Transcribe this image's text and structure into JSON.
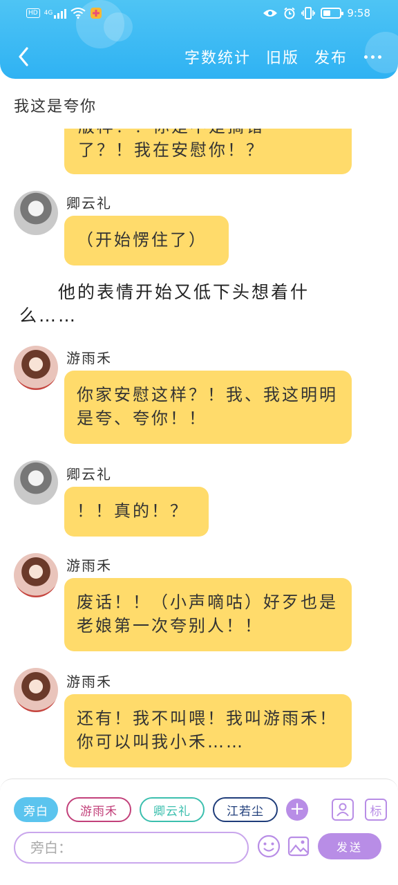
{
  "status_bar": {
    "hd": "HD",
    "network": "4G",
    "time": "9:58"
  },
  "header": {
    "actions": [
      {
        "label": "字数统计"
      },
      {
        "label": "旧版"
      },
      {
        "label": "发布"
      }
    ]
  },
  "chat": {
    "note_title": "我这是夸你",
    "partial_bubble_lines": [
      "版样！！你是不是搞错",
      "了？！我在安慰你！？"
    ],
    "messages": [
      {
        "sender": "卿云礼",
        "text": "（开始愣住了）"
      },
      {
        "narration": "　　他的表情开始又低下头想着什么……"
      },
      {
        "sender": "游雨禾",
        "text": "你家安慰这样？！我、我这明明是夸、夸你！！"
      },
      {
        "sender": "卿云礼",
        "text": "！！真的！？"
      },
      {
        "sender": "游雨禾",
        "text": "废话！！（小声嘀咕）好歹也是老娘第一次夸别人！！"
      },
      {
        "sender": "游雨禾",
        "text": "还有！我不叫喂！我叫游雨禾！你可以叫我小禾……"
      }
    ]
  },
  "input_panel": {
    "roles": [
      "旁白",
      "游雨禾",
      "卿云礼",
      "江若尘"
    ],
    "add_label": "+",
    "tag_label": "标",
    "placeholder": "旁白：",
    "send_label": "发送"
  },
  "colors": {
    "header": "#2fb2f3",
    "bubble": "#ffdb6b",
    "accent": "#b88de6",
    "role_narrator": "#5bc4ee",
    "role_youyuhe": "#c2407a",
    "role_qingyunli": "#3bbfae",
    "role_jiangruochen": "#1f3d7a"
  }
}
